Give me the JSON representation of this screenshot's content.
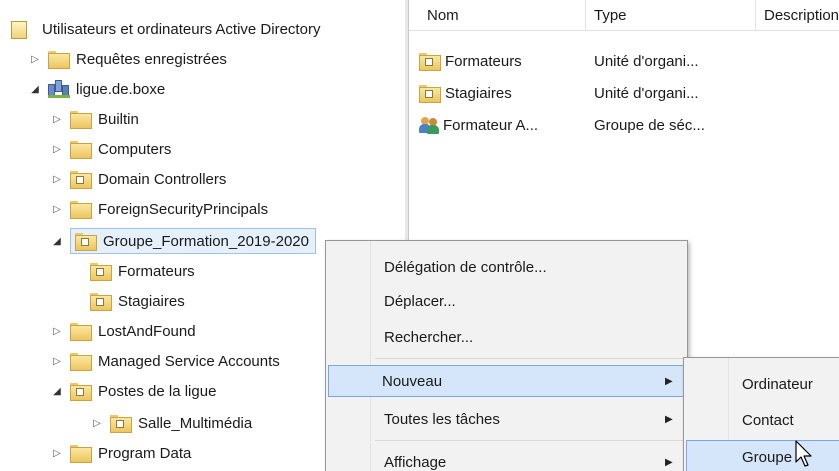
{
  "tree": {
    "root": "Utilisateurs et ordinateurs Active Directory",
    "saved_queries": "Requêtes enregistrées",
    "domain": "ligue.de.boxe",
    "builtin": "Builtin",
    "computers": "Computers",
    "domain_controllers": "Domain Controllers",
    "fsp": "ForeignSecurityPrincipals",
    "groupe_formation": "Groupe_Formation_2019-2020",
    "formateurs": "Formateurs",
    "stagiaires": "Stagiaires",
    "lostandfound": "LostAndFound",
    "msa": "Managed Service Accounts",
    "postes": "Postes de la ligue",
    "salle": "Salle_Multimédia",
    "program_data": "Program Data"
  },
  "list": {
    "headers": [
      "Nom",
      "Type",
      "Description"
    ],
    "rows": [
      {
        "name": "Formateurs",
        "type": "Unité d'organi...",
        "icon": "ou-icon"
      },
      {
        "name": "Stagiaires",
        "type": "Unité d'organi...",
        "icon": "ou-icon"
      },
      {
        "name": "Formateur A...",
        "type": "Groupe de séc...",
        "icon": "group-icon"
      }
    ]
  },
  "context_menu": {
    "delegation": "Délégation de contrôle...",
    "move": "Déplacer...",
    "find": "Rechercher...",
    "new": "Nouveau",
    "all_tasks": "Toutes les tâches",
    "view": "Affichage"
  },
  "submenu": {
    "computer": "Ordinateur",
    "contact": "Contact",
    "group": "Groupe"
  },
  "colors": {
    "highlight": "#d5e6fa",
    "selection_border": "#7aa8de",
    "menu_bg": "#f2f2f2"
  }
}
